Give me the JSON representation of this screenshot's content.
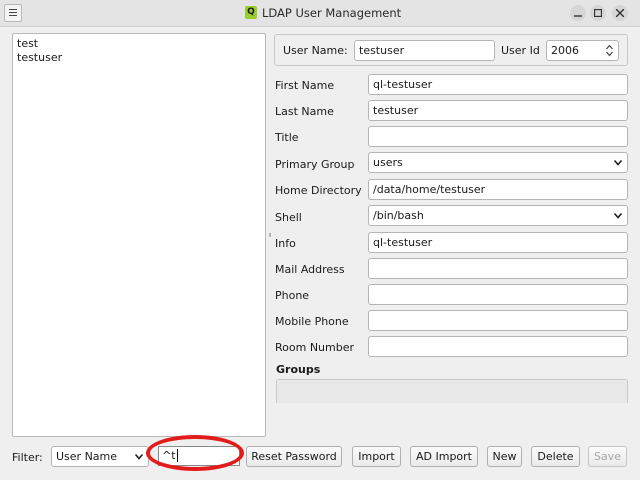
{
  "window": {
    "title": "LDAP User Management",
    "app_icon_letter": "Q"
  },
  "user_list": [
    "test",
    "testuser"
  ],
  "header": {
    "username_label": "User Name:",
    "username_value": "testuser",
    "userid_label": "User Id",
    "userid_value": "2006"
  },
  "fields": {
    "first_name": {
      "label": "First Name",
      "value": "ql-testuser"
    },
    "last_name": {
      "label": "Last Name",
      "value": "testuser"
    },
    "title": {
      "label": "Title",
      "value": ""
    },
    "primary_group": {
      "label": "Primary Group",
      "value": "users"
    },
    "home_directory": {
      "label": "Home Directory",
      "value": "/data/home/testuser"
    },
    "shell": {
      "label": "Shell",
      "value": "/bin/bash"
    },
    "info": {
      "label": "Info",
      "value": "ql-testuser"
    },
    "mail_address": {
      "label": "Mail Address",
      "value": ""
    },
    "phone": {
      "label": "Phone",
      "value": ""
    },
    "mobile_phone": {
      "label": "Mobile Phone",
      "value": ""
    },
    "room_number": {
      "label": "Room Number",
      "value": ""
    }
  },
  "groups": {
    "label": "Groups"
  },
  "bottom": {
    "filter_label": "Filter:",
    "filter_field": "User Name",
    "filter_value": "^t",
    "buttons": {
      "reset_password": "Reset Password",
      "import": "Import",
      "ad_import": "AD Import",
      "new": "New",
      "delete": "Delete",
      "save": "Save"
    }
  },
  "colors": {
    "highlight": "#e21b1b",
    "icon": "#9acd32"
  }
}
